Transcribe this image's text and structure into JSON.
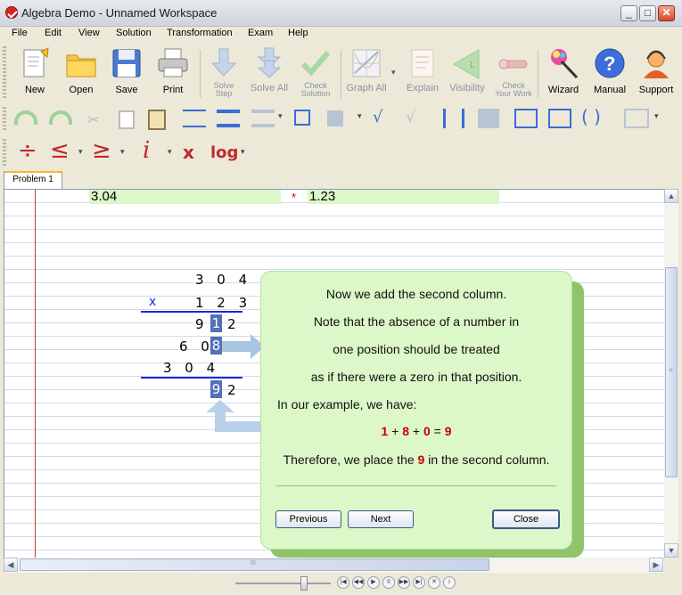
{
  "window": {
    "title": "Algebra Demo - Unnamed Workspace",
    "min": "_",
    "max": "□",
    "close": "✕"
  },
  "menu": [
    "File",
    "Edit",
    "View",
    "Solution",
    "Transformation",
    "Exam",
    "Help"
  ],
  "toolbar": {
    "new": "New",
    "open": "Open",
    "save": "Save",
    "print": "Print",
    "solve_step": [
      "Solve",
      "Step"
    ],
    "solve_all": "Solve All",
    "check_solution": [
      "Check",
      "Solution"
    ],
    "graph_all": "Graph All",
    "explain": "Explain",
    "visibility": "Visibility",
    "check_work": [
      "Check",
      "Your Work"
    ],
    "wizard": "Wizard",
    "manual": "Manual",
    "support": "Support"
  },
  "symbols": {
    "divide": "÷",
    "le": "≤",
    "ge": "≥",
    "italic_i": "i",
    "x": "x",
    "log": "log",
    "drop": "▾",
    "paren": "( )",
    "sqrt": "√"
  },
  "tab": "Problem 1",
  "expression": {
    "left": "3.04",
    "op": "*",
    "right": "1.23"
  },
  "multiplication": {
    "top": "3 0 4",
    "times": "x",
    "bottom": "1 2 3",
    "p1_a": "9",
    "p1_b": "1",
    "p1_c": "2",
    "p2_a": "6 0",
    "p2_b": "8",
    "p3": "3 0 4",
    "result_a": "9",
    "result_b": "2"
  },
  "explanation": {
    "lines": [
      "Now we add the second column.",
      "Note that the absence of a number in",
      "one position should be treated",
      "as if there were a zero in that position.",
      "In our example, we have:"
    ],
    "eq": {
      "a": "1",
      "plus1": "+",
      "b": "8",
      "plus2": "+",
      "c": "0",
      "eq": "=",
      "r": "9"
    },
    "conclusion_pre": "Therefore, we place the",
    "conclusion_num": "9",
    "conclusion_post": "in the second column."
  },
  "buttons": {
    "previous": "Previous",
    "next": "Next",
    "close": "Close"
  },
  "scroll": {
    "grip": "≡",
    "hgrip": "III",
    "left": "◀",
    "right": "▶",
    "up": "▲",
    "down": "▼"
  },
  "player": {
    "first": "|◀",
    "prev": "◀◀",
    "play": "▶",
    "pause": "II",
    "next": "▶▶",
    "last": "▶|",
    "stop": "✕",
    "info": "i"
  },
  "colors": {
    "accent_green": "#dcf7c8",
    "highlight": "#5470b6",
    "line_blue": "#1a2ad0",
    "red": "#cc0000"
  }
}
